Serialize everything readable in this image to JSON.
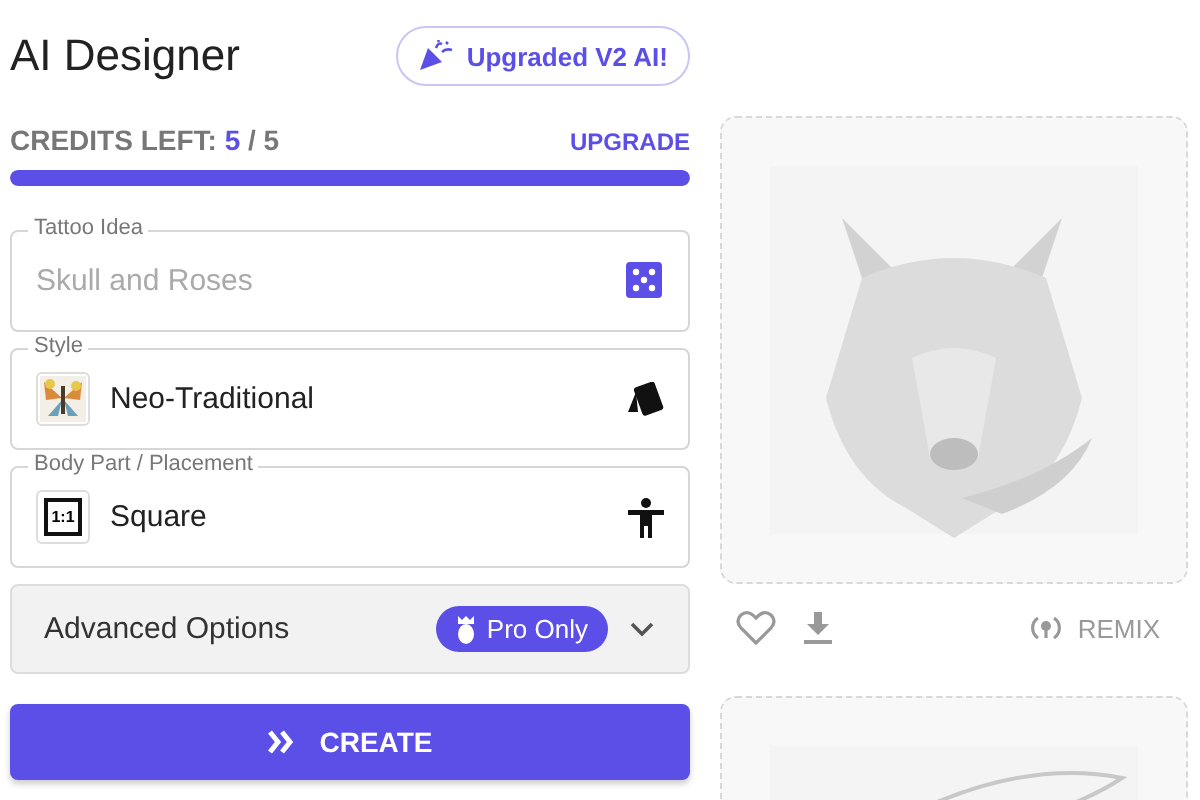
{
  "header": {
    "title": "AI Designer",
    "badge": "Upgraded V2 AI!"
  },
  "credits": {
    "label": "CREDITS LEFT:",
    "count": "5",
    "total": "/ 5",
    "level": 1,
    "upgrade": "UPGRADE"
  },
  "fields": [
    {
      "kind": "text",
      "legend": "Tattoo Idea",
      "placeholder": "Skull and Roses"
    },
    {
      "kind": "select",
      "legend": "Style",
      "value": "Neo-Traditional",
      "thumbnail": {
        "kind": "picture"
      }
    },
    {
      "kind": "select",
      "legend": "Body Part / Placement",
      "value": "Square",
      "thumbnail": {
        "kind": "ratio",
        "text": "1:1"
      }
    }
  ],
  "advanced": {
    "label": "Advanced Options",
    "badge": "Pro Only",
    "expanded": false
  },
  "create": "CREATE",
  "results": [
    {
      "kind": "picture",
      "remix": "REMIX"
    },
    {
      "kind": "picture"
    }
  ]
}
